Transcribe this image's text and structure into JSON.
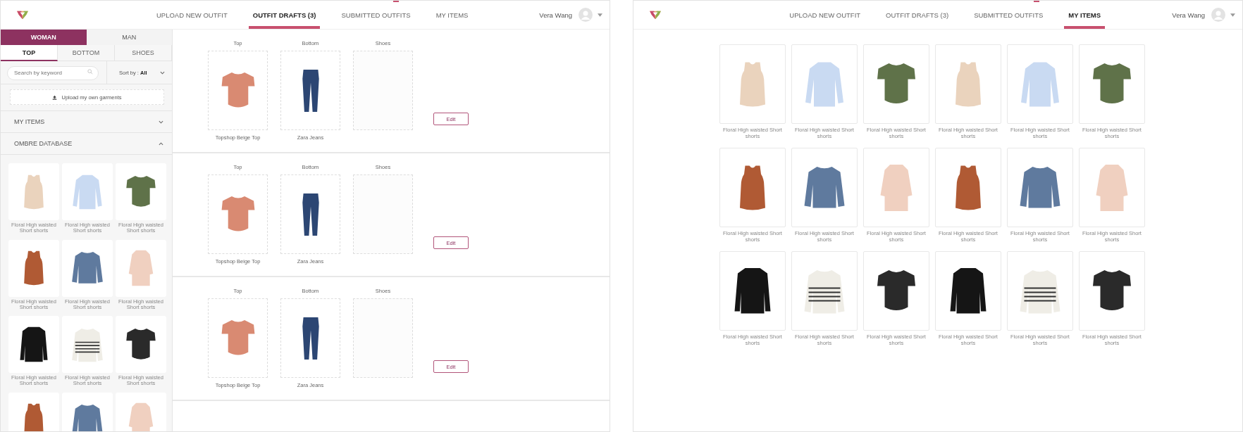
{
  "screens": [
    {
      "kind": "drafts",
      "nav": [
        {
          "label": "UPLOAD NEW OUTFIT",
          "selected": false
        },
        {
          "label": "OUTFIT DRAFTS (3)",
          "selected": true
        },
        {
          "label": "SUBMITTED OUTFITS",
          "selected": false
        },
        {
          "label": "MY ITEMS",
          "selected": false
        }
      ],
      "user": "Vera Wang",
      "sidebar": {
        "gender_tabs": [
          {
            "label": "WOMAN",
            "selected": true
          },
          {
            "label": "MAN",
            "selected": false
          }
        ],
        "category_tabs": [
          {
            "label": "TOP",
            "selected": true
          },
          {
            "label": "BOTTOM",
            "selected": false
          },
          {
            "label": "SHOES",
            "selected": false
          }
        ],
        "search": {
          "placeholder": "Search by keyword"
        },
        "sort": {
          "label": "Sort by :",
          "value": "All"
        },
        "upload_button": "Upload my own garments",
        "sections": [
          {
            "label": "MY ITEMS",
            "expanded": false
          },
          {
            "label": "OMBRE DATABASE",
            "expanded": true
          }
        ],
        "products": [
          {
            "name": "Floral High waisted Short shorts",
            "kind": "tank",
            "color": "#ead3bd"
          },
          {
            "name": "Floral High waisted Short shorts",
            "kind": "shirt",
            "color": "#c9daf2"
          },
          {
            "name": "Floral High waisted Short shorts",
            "kind": "tee",
            "color": "#5f7249"
          },
          {
            "name": "Floral High waisted Short shorts",
            "kind": "tank",
            "color": "#b05a34"
          },
          {
            "name": "Floral High waisted Short shorts",
            "kind": "sweater",
            "color": "#5f7a9e"
          },
          {
            "name": "Floral High waisted Short shorts",
            "kind": "coat",
            "color": "#f0d0c0"
          },
          {
            "name": "Floral High waisted Short shorts",
            "kind": "blazer",
            "color": "#151515"
          },
          {
            "name": "Floral High waisted Short shorts",
            "kind": "striped",
            "color": "#efede6"
          },
          {
            "name": "Floral High waisted Short shorts",
            "kind": "tee",
            "color": "#2a2a2a"
          },
          {
            "kind": "tank",
            "color": "#b05a34"
          },
          {
            "kind": "sweater",
            "color": "#5f7a9e"
          },
          {
            "kind": "coat",
            "color": "#f0d0c0"
          }
        ]
      },
      "drafts": [
        {
          "slots": [
            {
              "label": "Top",
              "item": "Topshop Beige Top",
              "kind": "tee",
              "color": "#d98a72"
            },
            {
              "label": "Bottom",
              "item": "Zara Jeans",
              "kind": "jeans",
              "color": "#2c4673"
            },
            {
              "label": "Shoes"
            }
          ],
          "edit_button": "Edit"
        },
        {
          "slots": [
            {
              "label": "Top",
              "item": "Topshop Beige Top",
              "kind": "tee",
              "color": "#d98a72"
            },
            {
              "label": "Bottom",
              "item": "Zara Jeans",
              "kind": "jeans",
              "color": "#2c4673"
            },
            {
              "label": "Shoes"
            }
          ],
          "edit_button": "Edit"
        },
        {
          "slots": [
            {
              "label": "Top",
              "item": "Topshop Beige Top",
              "kind": "tee",
              "color": "#d98a72"
            },
            {
              "label": "Bottom",
              "item": "Zara Jeans",
              "kind": "jeans",
              "color": "#2c4673"
            },
            {
              "label": "Shoes"
            }
          ],
          "edit_button": "Edit"
        }
      ]
    },
    {
      "kind": "items",
      "nav": [
        {
          "label": "UPLOAD NEW OUTFIT",
          "selected": false
        },
        {
          "label": "OUTFIT DRAFTS (3)",
          "selected": false
        },
        {
          "label": "SUBMITTED OUTFITS",
          "selected": false
        },
        {
          "label": "MY ITEMS",
          "selected": true
        }
      ],
      "user": "Vera Wang",
      "items": [
        {
          "name": "Floral High waisted Short shorts",
          "kind": "tank",
          "color": "#ead3bd"
        },
        {
          "name": "Floral High waisted Short shorts",
          "kind": "shirt",
          "color": "#c9daf2"
        },
        {
          "name": "Floral High waisted Short shorts",
          "kind": "tee",
          "color": "#5f7249"
        },
        {
          "name": "Floral High waisted Short shorts",
          "kind": "tank",
          "color": "#ead3bd"
        },
        {
          "name": "Floral High waisted Short shorts",
          "kind": "shirt",
          "color": "#c9daf2"
        },
        {
          "name": "Floral High waisted Short shorts",
          "kind": "tee",
          "color": "#5f7249"
        },
        {
          "name": "Floral High waisted Short shorts",
          "kind": "tank",
          "color": "#b05a34"
        },
        {
          "name": "Floral High waisted Short shorts",
          "kind": "sweater",
          "color": "#5f7a9e"
        },
        {
          "name": "Floral High waisted Short shorts",
          "kind": "coat",
          "color": "#f0d0c0"
        },
        {
          "name": "Floral High waisted Short shorts",
          "kind": "tank",
          "color": "#b05a34"
        },
        {
          "name": "Floral High waisted Short shorts",
          "kind": "sweater",
          "color": "#5f7a9e"
        },
        {
          "name": "Floral High waisted Short shorts",
          "kind": "coat",
          "color": "#f0d0c0"
        },
        {
          "name": "Floral High waisted Short shorts",
          "kind": "blazer",
          "color": "#151515"
        },
        {
          "name": "Floral High waisted Short shorts",
          "kind": "striped",
          "color": "#efede6"
        },
        {
          "name": "Floral High waisted Short shorts",
          "kind": "tee",
          "color": "#2a2a2a"
        },
        {
          "name": "Floral High waisted Short shorts",
          "kind": "blazer",
          "color": "#151515"
        },
        {
          "name": "Floral High waisted Short shorts",
          "kind": "striped",
          "color": "#efede6"
        },
        {
          "name": "Floral High waisted Short shorts",
          "kind": "tee",
          "color": "#2a2a2a"
        }
      ]
    }
  ]
}
